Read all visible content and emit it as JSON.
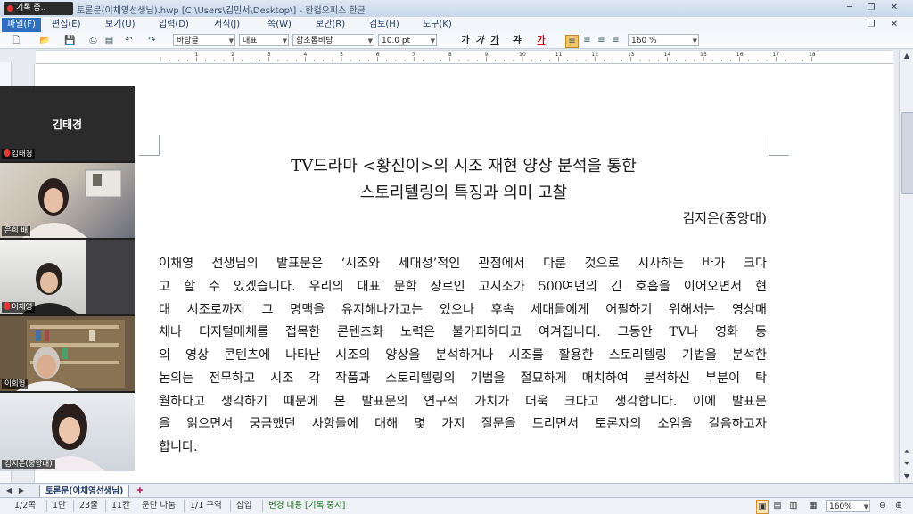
{
  "titlebar": {
    "recording_badge": "기록 중..",
    "title": "토론문(이채영선생님).hwp [C:\\Users\\김민서\\Desktop\\] - 한컴오피스 한글"
  },
  "menu": [
    "파일(F)",
    "편집(E)",
    "보기(U)",
    "입력(D)",
    "서식(J)",
    "쪽(W)",
    "보안(R)",
    "검토(H)",
    "도구(K)"
  ],
  "toolbar": {
    "style": "바탕글",
    "para_style": "대표",
    "font": "함초롬바탕",
    "font_size": "10.0",
    "size_unit": "pt",
    "zoom": "160",
    "zoom_unit": "%"
  },
  "ruler": {
    "numbers": [
      "1",
      "2",
      "3",
      "4",
      "5",
      "6",
      "7",
      "8",
      "9",
      "10",
      "11",
      "12",
      "13",
      "14",
      "15",
      "16",
      "17",
      "18"
    ]
  },
  "document": {
    "title_line1": "TV드라마 <황진이>의 시조 재현 양상 분석을 통한",
    "title_line2": "스토리텔링의 특징과 의미 고찰",
    "author": "김지은(중앙대)",
    "lines": [
      "  이채영 선생님의 발표문은 ‘시조와 세대성’적인 관점에서 다룬 것으로 시사하는 바가 크다",
      "고 할 수 있겠습니다. 우리의 대표 문학 장르인 고시조가 500여년의 긴 호흡을 이어오면서 현",
      "대 시조로까지 그 명맥을 유지해나가고는 있으나 후속 세대들에게 어필하기 위해서는 영상매",
      "체나 디지털매체를 접목한 콘텐츠화 노력은 불가피하다고 여겨집니다. 그동안 TV나 영화 등",
      "의 영상 콘텐츠에 나타난 시조의 양상을 분석하거나 시조를 활용한 스토리텔링 기법을 분석한",
      "논의는 전무하고 시조 각 작품과 스토리텔링의 기법을 절묘하게 매치하여 분석하신 부분이 탁",
      "월하다고 생각하기 때문에 본 발표문의 연구적 가치가 더욱 크다고 생각합니다. 이에 발표문",
      "을 읽으면서 궁금했던 사항들에 대해 몇 가지 질문을 드리면서 토론자의 소임을 갈음하고자",
      "합니다."
    ]
  },
  "doc_tab": "토론문(이채영선생님)",
  "status": {
    "page": "1/2쪽",
    "section": "1단",
    "line": "23줄",
    "column": "11칸",
    "para_split": "문단 나눔",
    "section_no": "1/1 구역",
    "insert_mode": "삽입",
    "track_changes": "변경 내용 [기록 중지]",
    "zoom": "160%"
  },
  "zoom_panel": {
    "host_name": "김태경",
    "participants": [
      {
        "label": "김태경",
        "muted": true
      },
      {
        "label": "은희 배",
        "muted": false
      },
      {
        "label": "이채영",
        "muted": true
      },
      {
        "label": "이회형",
        "muted": false
      },
      {
        "label": "김지은(중앙대)",
        "muted": false
      }
    ]
  },
  "colors": {
    "accent": "#2f6fc2",
    "recording": "#e53935",
    "track_changes": "#1b6e1b"
  }
}
